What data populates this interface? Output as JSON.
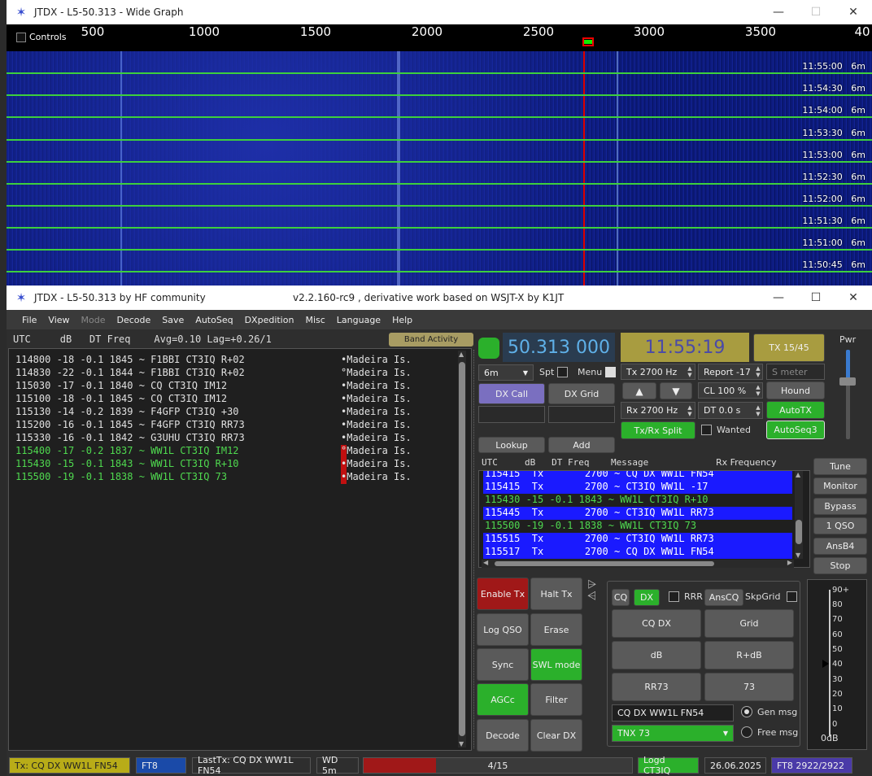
{
  "wide_graph": {
    "title": "JTDX - L5-50.313 - Wide Graph",
    "controls_label": "Controls",
    "ruler_ticks": [
      "500",
      "1000",
      "1500",
      "2000",
      "2500",
      "3000",
      "3500",
      "40"
    ],
    "rows": [
      {
        "time": "11:55:00",
        "band": "6m"
      },
      {
        "time": "11:54:30",
        "band": "6m"
      },
      {
        "time": "11:54:00",
        "band": "6m"
      },
      {
        "time": "11:53:30",
        "band": "6m"
      },
      {
        "time": "11:53:00",
        "band": "6m"
      },
      {
        "time": "11:52:30",
        "band": "6m"
      },
      {
        "time": "11:52:00",
        "band": "6m"
      },
      {
        "time": "11:51:30",
        "band": "6m"
      },
      {
        "time": "11:51:00",
        "band": "6m"
      },
      {
        "time": "11:50:45",
        "band": "6m"
      }
    ]
  },
  "main": {
    "title_left": "JTDX - L5-50.313  by HF community",
    "title_center": "v2.2.160-rc9 , derivative work based on WSJT-X by K1JT",
    "menu": [
      "File",
      "View",
      "Mode",
      "Decode",
      "Save",
      "AutoSeq",
      "DXpedition",
      "Misc",
      "Language",
      "Help"
    ],
    "menu_disabled": "Mode"
  },
  "band_activity": {
    "header": "UTC     dB   DT Freq    Avg=0.10 Lag=+0.26/1",
    "button": "Band Activity",
    "rows": [
      {
        "text": "114800 -18 -0.1 1845 ~ F1BBI CT3IQ R+02",
        "dxcc": "•Madeira Is.",
        "color": "white",
        "marker": ""
      },
      {
        "text": "114830 -22 -0.1 1844 ~ F1BBI CT3IQ R+02",
        "dxcc": "°Madeira Is.",
        "color": "white",
        "marker": ""
      },
      {
        "text": "115030 -17 -0.1 1840 ~ CQ CT3IQ IM12",
        "dxcc": "•Madeira Is.",
        "color": "white",
        "marker": ""
      },
      {
        "text": "115100 -18 -0.1 1845 ~ CQ CT3IQ IM12",
        "dxcc": "•Madeira Is.",
        "color": "white",
        "marker": ""
      },
      {
        "text": "115130 -14 -0.2 1839 ~ F4GFP CT3IQ +30",
        "dxcc": "•Madeira Is.",
        "color": "white",
        "marker": ""
      },
      {
        "text": "115200 -16 -0.1 1845 ~ F4GFP CT3IQ RR73",
        "dxcc": "•Madeira Is.",
        "color": "white",
        "marker": ""
      },
      {
        "text": "115330 -16 -0.1 1842 ~ G3UHU CT3IQ RR73",
        "dxcc": "•Madeira Is.",
        "color": "white",
        "marker": ""
      },
      {
        "text": "115400 -17 -0.2 1837 ~ WW1L CT3IQ IM12",
        "dxcc": "°Madeira Is.",
        "color": "green",
        "marker": "red"
      },
      {
        "text": "115430 -15 -0.1 1843 ~ WW1L CT3IQ R+10",
        "dxcc": "•Madeira Is.",
        "color": "green",
        "marker": "red"
      },
      {
        "text": "115500 -19 -0.1 1838 ~ WW1L CT3IQ 73",
        "dxcc": "•Madeira Is.",
        "color": "green",
        "marker": "red"
      }
    ]
  },
  "controls": {
    "frequency": "50.313 000",
    "clock": "11:55:19",
    "tx_period": "TX 15/45",
    "pwr_label": "Pwr",
    "band": "6m",
    "spt_label": "Spt",
    "menu_label": "Menu",
    "tx_hz": "Tx  2700  Hz",
    "rx_hz": "Rx  2700  Hz",
    "report": "Report -17",
    "s_meter": "S meter",
    "cl": "CL  100 %",
    "dt": "DT 0.0 s",
    "hound": "Hound",
    "autotx": "AutoTX",
    "autoseq3": "AutoSeq3",
    "wanted": "Wanted",
    "txrx_split": "Tx/Rx Split",
    "dx_call": "DX Call",
    "dx_grid": "DX Grid",
    "lookup": "Lookup",
    "add": "Add",
    "up_arrow": "▲",
    "down_arrow": "▼"
  },
  "message_list": {
    "header": "UTC     dB   DT Freq    Message",
    "rx_freq_label": "Rx Frequency",
    "rows": [
      {
        "text": "115415  Tx       2700 ~ CQ DX WW1L FN54",
        "type": "tx"
      },
      {
        "text": "115415  Tx       2700 ~ CT3IQ WW1L -17",
        "type": "tx"
      },
      {
        "text": "115430 -15 -0.1 1843 ~ WW1L CT3IQ R+10",
        "type": "rx"
      },
      {
        "text": "115445  Tx       2700 ~ CT3IQ WW1L RR73",
        "type": "tx"
      },
      {
        "text": "115500 -19 -0.1 1838 ~ WW1L CT3IQ 73",
        "type": "rx"
      },
      {
        "text": "115515  Tx       2700 ~ CT3IQ WW1L RR73",
        "type": "tx"
      },
      {
        "text": "115517  Tx       2700 ~ CQ DX WW1L FN54",
        "type": "tx"
      }
    ]
  },
  "side_buttons": [
    "Tune",
    "Monitor",
    "Bypass",
    "1 QSO",
    "AnsB4",
    "Stop"
  ],
  "action_buttons": {
    "enable_tx": "Enable Tx",
    "halt_tx": "Halt Tx",
    "log_qso": "Log QSO",
    "erase": "Erase",
    "sync": "Sync",
    "swl_mode": "SWL mode",
    "agcc": "AGCc",
    "filter": "Filter",
    "decode": "Decode",
    "clear_dx": "Clear DX"
  },
  "gen_panel": {
    "cq": "CQ",
    "dx": "DX",
    "rrr": "RRR",
    "anscq": "AnsCQ",
    "skpgrid": "SkpGrid",
    "cq_dx": "CQ DX",
    "grid": "Grid",
    "db": "dB",
    "rdb": "R+dB",
    "rr73": "RR73",
    "s73": "73",
    "gen_msg_text": "CQ DX WW1L FN54",
    "gen_msg_label": "Gen msg",
    "free_msg_select": "TNX 73",
    "free_msg_label": "Free msg"
  },
  "meter": {
    "ticks": [
      "90+",
      "80",
      "70",
      "60",
      "50",
      "40",
      "30",
      "20",
      "10",
      "0"
    ],
    "label": "0dB"
  },
  "statusbar": {
    "tx_msg": "Tx: CQ DX WW1L FN54",
    "mode": "FT8",
    "last_tx": "LastTx: CQ DX WW1L FN54",
    "wd": "WD 5m",
    "progress_text": "4/15",
    "progress_fraction": 0.27,
    "logged": "Logd CT3IQ",
    "date": "26.06.2025",
    "ft8_count": "FT8  2922/2922"
  },
  "colors": {
    "tx_row": "#1a1aff",
    "rx_row_text": "#4fd94f",
    "enable_tx": "#a01818",
    "green_btn": "#2bb02b",
    "purple_btn": "#7a6fc0",
    "gold": "#a89c40"
  }
}
